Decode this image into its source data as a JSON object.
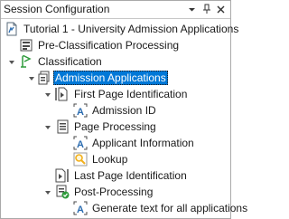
{
  "panel": {
    "title": "Session Configuration",
    "buttons": {
      "dropdown": "▾",
      "pin": "ᵖ",
      "close": "✕"
    }
  },
  "tree": {
    "root": "Tutorial 1 - University Admission Applications",
    "pre_classification": "Pre-Classification Processing",
    "classification": "Classification",
    "admission_applications": "Admission Applications",
    "first_page_identification": "First Page Identification",
    "admission_id": "Admission ID",
    "page_processing": "Page Processing",
    "applicant_information": "Applicant Information",
    "lookup": "Lookup",
    "last_page_identification": "Last Page Identification",
    "post_processing": "Post-Processing",
    "generate_text": "Generate text for all applications"
  },
  "colors": {
    "selection": "#0078d7",
    "accent_blue": "#2b6cb0",
    "accent_green": "#2e9b3b",
    "accent_yellow": "#f2b01e"
  }
}
